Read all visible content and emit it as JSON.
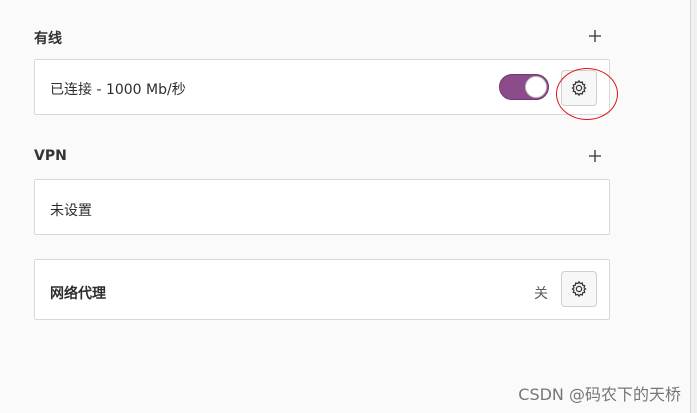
{
  "wired": {
    "title": "有线",
    "add_label": "+",
    "connection_text": "已连接 - 1000 Mb/秒",
    "toggle_on": true
  },
  "vpn": {
    "title": "VPN",
    "add_label": "+",
    "status_text": "未设置"
  },
  "proxy": {
    "title": "网络代理",
    "state_text": "关"
  },
  "watermark": "CSDN @码农下的天桥",
  "colors": {
    "toggle_on": "#8c4c8c",
    "annotation": "#e0151b"
  },
  "icons": [
    "plus-icon",
    "gear-icon"
  ]
}
